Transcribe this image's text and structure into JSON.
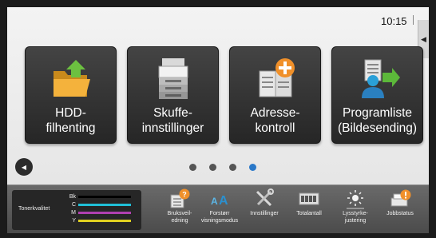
{
  "status": {
    "time": "10:15"
  },
  "tiles": [
    {
      "label_line1": "HDD-",
      "label_line2": "filhenting",
      "icon": "folder-arrow-icon"
    },
    {
      "label_line1": "Skuffe-",
      "label_line2": "innstillinger",
      "icon": "printer-icon"
    },
    {
      "label_line1": "Adresse-",
      "label_line2": "kontroll",
      "icon": "address-book-add-icon"
    },
    {
      "label_line1": "Programliste",
      "label_line2": "(Bildesending)",
      "icon": "send-program-icon"
    }
  ],
  "pager": {
    "pages": 4,
    "active_index": 3
  },
  "toner": {
    "title": "Tonerkvalitet",
    "levels": [
      {
        "label": "Bk",
        "color": "#000000"
      },
      {
        "label": "C",
        "color": "#20c0d8"
      },
      {
        "label": "M",
        "color": "#b040b0"
      },
      {
        "label": "Y",
        "color": "#e0d020"
      }
    ]
  },
  "bottom_buttons": [
    {
      "label_line1": "Bruksveil-",
      "label_line2": "edning",
      "icon": "help-book-icon"
    },
    {
      "label_line1": "Forstørr",
      "label_line2": "visningsmodus",
      "icon": "enlarge-text-icon"
    },
    {
      "label_line1": "Innstillinger",
      "label_line2": "",
      "icon": "tools-icon"
    },
    {
      "label_line1": "Totalantall",
      "label_line2": "",
      "icon": "counter-icon"
    },
    {
      "label_line1": "Lysstyrke-",
      "label_line2": "justering",
      "icon": "brightness-icon"
    },
    {
      "label_line1": "Jobbstatus",
      "label_line2": "",
      "icon": "job-status-icon"
    }
  ],
  "colors": {
    "accent_blue": "#2a78c8",
    "orange": "#f0902a",
    "green": "#5cb83a"
  }
}
